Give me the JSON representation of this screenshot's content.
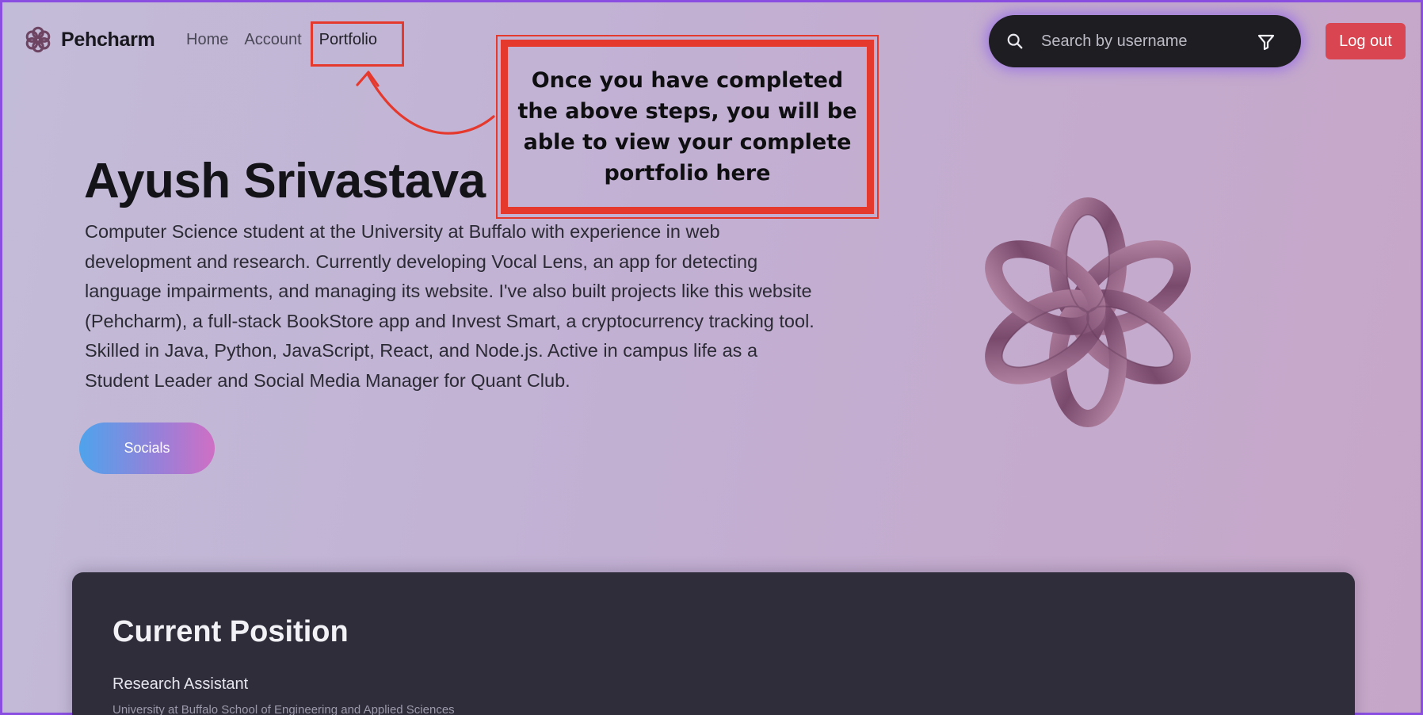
{
  "brand": {
    "name": "Pehcharm"
  },
  "nav": {
    "items": [
      {
        "label": "Home"
      },
      {
        "label": "Account"
      },
      {
        "label": "Portfolio"
      }
    ]
  },
  "search": {
    "placeholder": "Search by username"
  },
  "header": {
    "logout_label": "Log out"
  },
  "annotation": {
    "text": "Once you have completed the above steps, you will be able to view your complete portfolio here",
    "color": "#e5392e"
  },
  "hero": {
    "name": "Ayush Srivastava",
    "bio": "Computer Science student at the University at Buffalo with experience in web development and research. Currently developing Vocal Lens, an app for detecting language impairments, and managing its website. I've also built projects like this website (Pehcharm), a full-stack BookStore app and Invest Smart, a cryptocurrency tracking tool. Skilled in Java, Python, JavaScript, React, and Node.js. Active in campus life as a Student Leader and Social Media Manager for Quant Club.",
    "socials_label": "Socials"
  },
  "current_position": {
    "title": "Current Position",
    "role": "Research Assistant",
    "organization": "University at Buffalo School of Engineering and Applied Sciences"
  },
  "icons": [
    "brand-logo-icon",
    "search-icon",
    "filter-icon",
    "knot-illustration-icon",
    "annotation-arrow-icon"
  ],
  "colors": {
    "logout": "#d94550",
    "card": "#2f2d3a",
    "search_bg": "#1e1d22",
    "accent_border": "#8a4fe0"
  }
}
